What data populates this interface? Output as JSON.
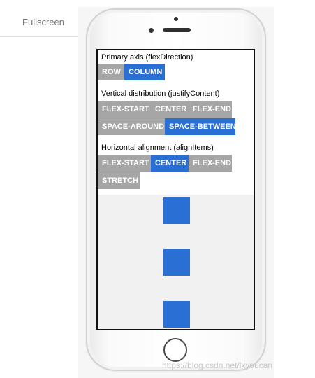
{
  "tab": {
    "label": "Fullscreen"
  },
  "screen": {
    "sections": [
      {
        "title": "Primary axis (flexDirection)",
        "options": [
          {
            "label": "ROW",
            "active": false
          },
          {
            "label": "COLUMN",
            "active": true
          }
        ]
      },
      {
        "title": "Vertical distribution (justifyContent)",
        "options": [
          {
            "label": "FLEX-START",
            "active": false
          },
          {
            "label": "CENTER",
            "active": false
          },
          {
            "label": "FLEX-END",
            "active": false
          },
          {
            "label": "SPACE-AROUND",
            "active": false
          },
          {
            "label": "SPACE-BETWEEN",
            "active": true
          }
        ]
      },
      {
        "title": "Horizontal alignment (alignItems)",
        "options": [
          {
            "label": "FLEX-START",
            "active": false
          },
          {
            "label": "CENTER",
            "active": true
          },
          {
            "label": "FLEX-END",
            "active": false
          },
          {
            "label": "STRETCH",
            "active": false
          }
        ]
      }
    ],
    "colors": {
      "active": "#2a6fd3",
      "inactive": "#a6a6a6",
      "box": "#2a6fd3"
    }
  },
  "watermark": "https://blog.csdn.net/lxyoucan"
}
